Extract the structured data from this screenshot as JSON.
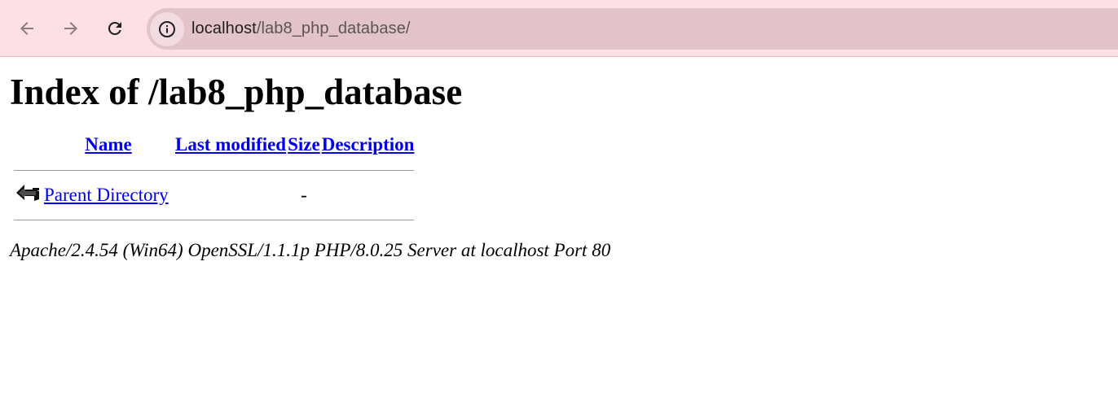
{
  "browser": {
    "url_host": "localhost",
    "url_path": "/lab8_php_database/",
    "icons": {
      "back": "arrow-left-icon",
      "forward": "arrow-right-icon",
      "reload": "reload-icon",
      "site_info": "info-circle-icon"
    }
  },
  "page": {
    "title": "Index of /lab8_php_database",
    "columns": {
      "name": "Name",
      "last_modified": "Last modified",
      "size": "Size",
      "description": "Description"
    },
    "rows": [
      {
        "icon": "back-arrow-folder-icon",
        "name": "Parent Directory",
        "last_modified": "",
        "size": "-",
        "description": ""
      }
    ],
    "footer": "Apache/2.4.54 (Win64) OpenSSL/1.1.1p PHP/8.0.25 Server at localhost Port 80"
  },
  "colors": {
    "toolbar_bg": "#fde0e6",
    "omnibox_bg": "#e2c3c9",
    "link": "#0000ee"
  }
}
